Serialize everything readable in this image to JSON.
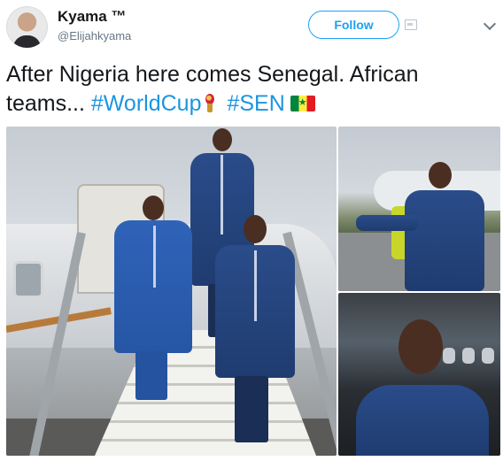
{
  "header": {
    "display_name": "Kyama ™",
    "handle": "@Elijahkyama",
    "follow_label": "Follow",
    "avatar_icon": "user-avatar-icon",
    "tip_icon": "tip-jar-icon",
    "menu_icon": "chevron-down-icon"
  },
  "tweet": {
    "line1": "After Nigeria here comes Senegal. African",
    "line2_prefix": "teams...",
    "hashtag1": "#WorldCup",
    "hashtag2": "#SEN",
    "emoji1": "world-cup-trophy-icon",
    "emoji2": "senegal-flag-icon"
  },
  "colors": {
    "accent": "#1da1f2",
    "hashtag": "#1b95e0",
    "text": "#14171a",
    "secondary": "#657786",
    "robe": "#2a4c8a"
  },
  "media": {
    "photos": [
      "photo-main",
      "photo-top-right",
      "photo-bottom-right"
    ]
  }
}
